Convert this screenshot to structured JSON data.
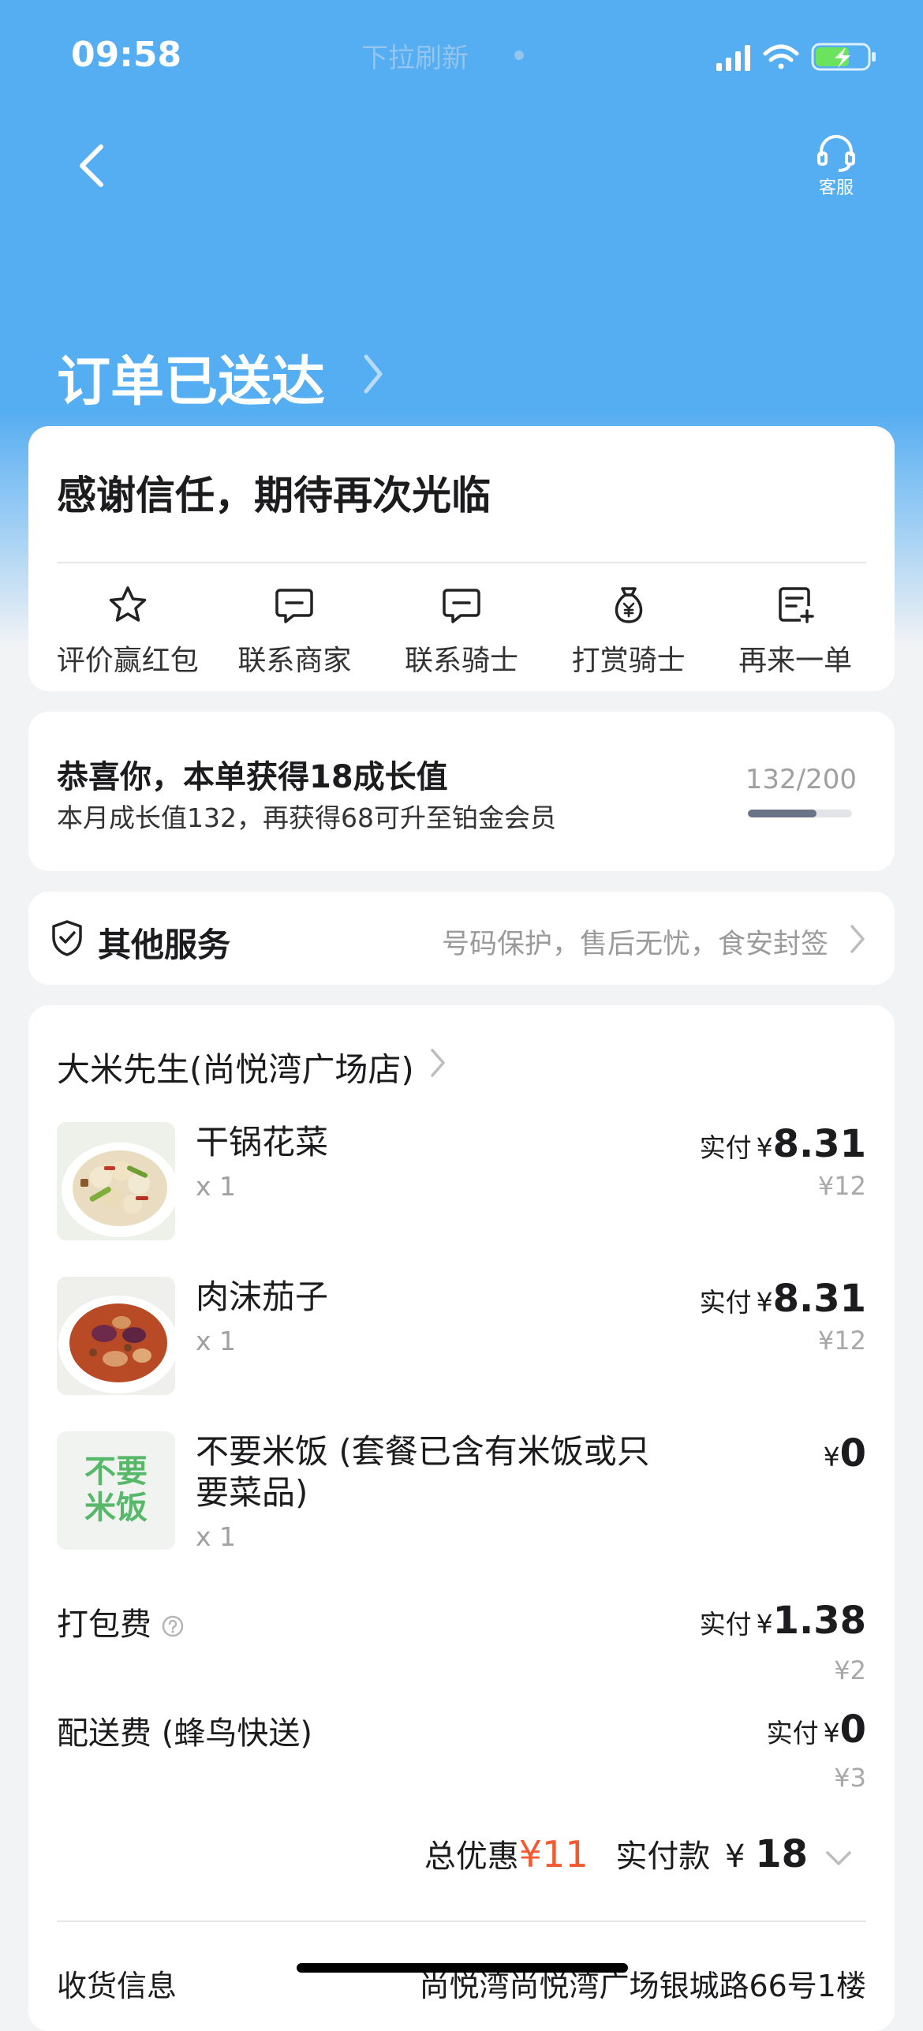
{
  "status_bar": {
    "time": "09:58",
    "pull_hint": "下拉刷新"
  },
  "header": {
    "customer_service_label": "客服",
    "order_status": "订单已送达"
  },
  "thanks_card": {
    "title": "感谢信任，期待再次光临",
    "actions": [
      {
        "label": "评价赢红包",
        "icon": "star-icon"
      },
      {
        "label": "联系商家",
        "icon": "chat-icon"
      },
      {
        "label": "联系骑士",
        "icon": "chat-icon"
      },
      {
        "label": "打赏骑士",
        "icon": "money-bag-icon"
      },
      {
        "label": "再来一单",
        "icon": "reorder-icon"
      }
    ]
  },
  "growth": {
    "title": "恭喜你，本单获得18成长值",
    "subtitle": "本月成长值132，再获得68可升至铂金会员",
    "progress_text": "132/200",
    "progress_fraction": 0.66
  },
  "services": {
    "title": "其他服务",
    "description": "号码保护，售后无忧，食安封签"
  },
  "order": {
    "shop_name": "大米先生(尚悦湾广场店)",
    "items": [
      {
        "name": "干锅花菜",
        "qty": "x 1",
        "paid_label": "实付",
        "currency": "¥",
        "price": "8.31",
        "original": "¥12"
      },
      {
        "name": "肉沫茄子",
        "qty": "x 1",
        "paid_label": "实付",
        "currency": "¥",
        "price": "8.31",
        "original": "¥12"
      },
      {
        "name": "不要米饭 (套餐已含有米饭或只要菜品)",
        "qty": "x 1",
        "currency": "¥",
        "price": "0",
        "thumb_text_1": "不要",
        "thumb_text_2": "米饭"
      }
    ],
    "packing_fee": {
      "name": "打包费",
      "paid_label": "实付",
      "currency": "¥",
      "price": "1.38",
      "original": "¥2"
    },
    "delivery_fee": {
      "name": "配送费 (蜂鸟快送)",
      "paid_label": "实付",
      "currency": "¥",
      "price": "0",
      "original": "¥3"
    },
    "total": {
      "discount_label": "总优惠",
      "discount_value": "¥11",
      "paid_label": "实付款",
      "currency": "¥",
      "paid_value": "18"
    },
    "address_label": "收货信息",
    "address_value": "尚悦湾尚悦湾广场银城路66号1楼"
  },
  "colors": {
    "header_blue": "#55adf2",
    "discount_red": "#f35a31",
    "progress_fill": "#6b7387"
  }
}
